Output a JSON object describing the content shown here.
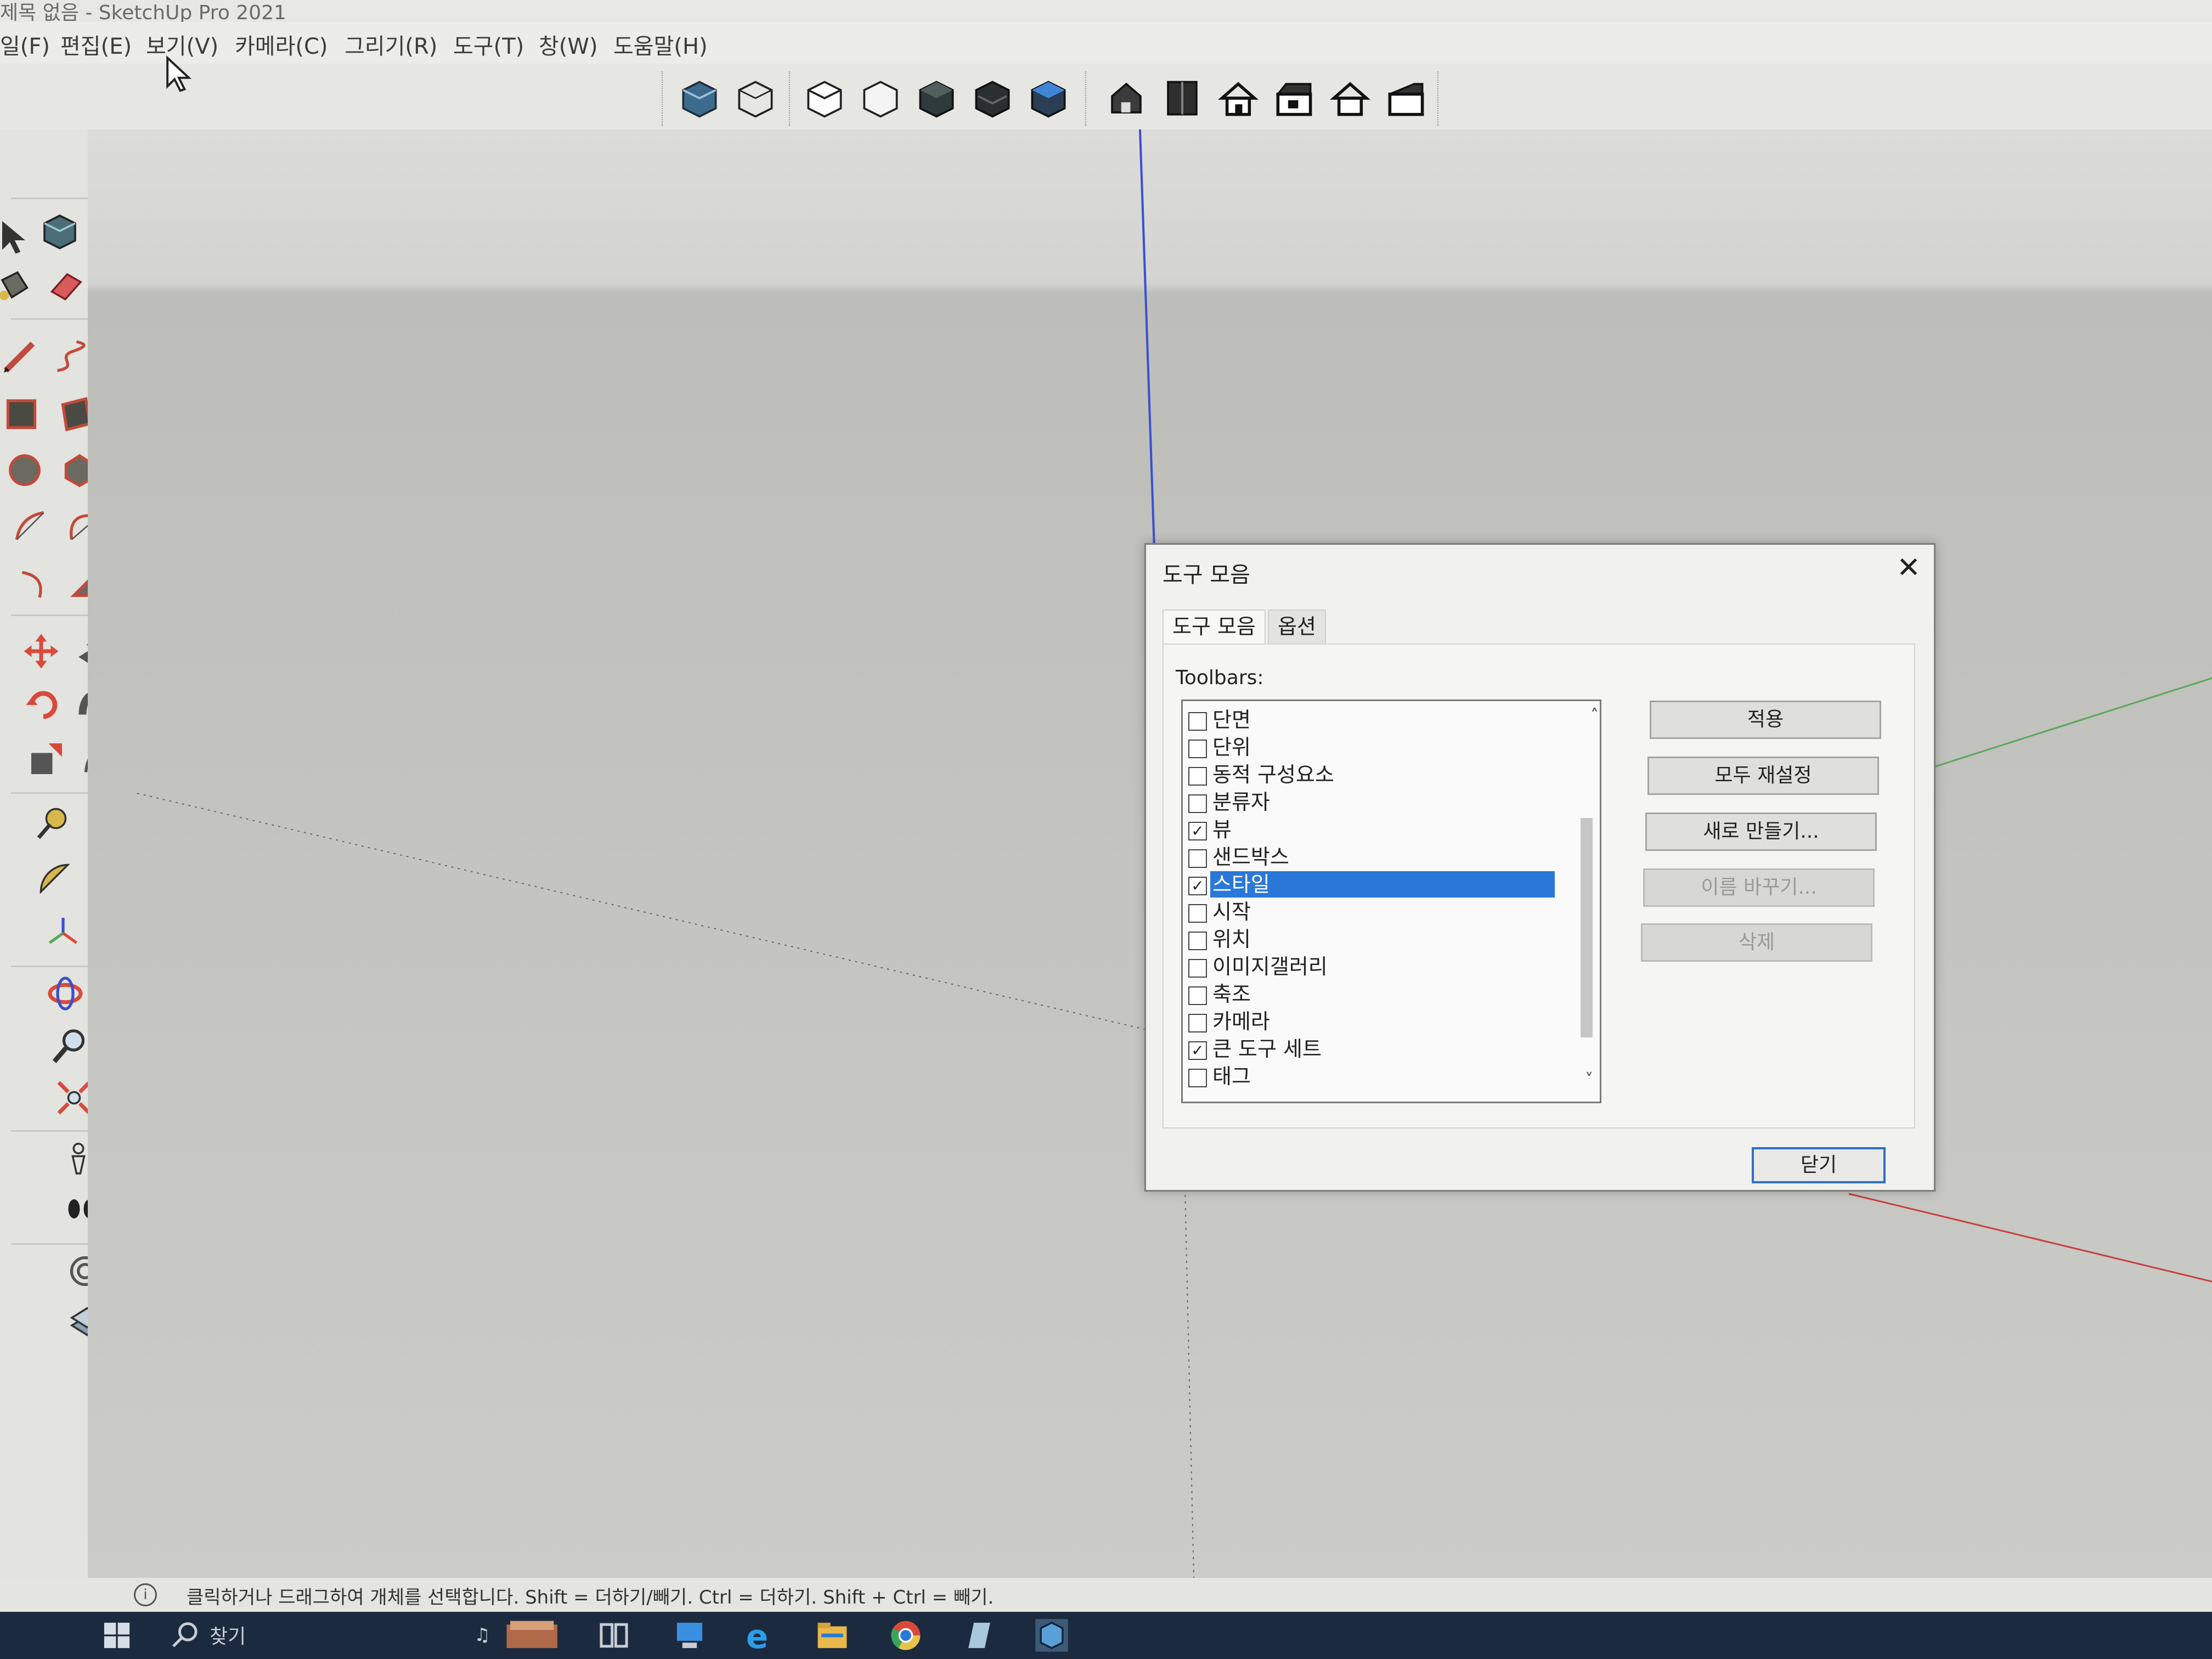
{
  "window": {
    "title": "제목 없음 - SketchUp Pro 2021"
  },
  "menu": {
    "items": [
      "일(F)",
      "편집(E)",
      "보기(V)",
      "카메라(C)",
      "그리기(R)",
      "도구(T)",
      "창(W)",
      "도움말(H)"
    ]
  },
  "top_toolbar": {
    "style_icons": [
      "xray-style-icon",
      "wireframe-style-icon",
      "hidden-line-style-icon",
      "hidden-line-white-icon",
      "shaded-style-icon",
      "shaded-textures-icon",
      "monochrome-style-icon"
    ],
    "view_icons": [
      "iso-view-icon",
      "top-view-icon",
      "front-view-icon",
      "right-view-icon",
      "back-view-icon",
      "left-view-icon"
    ]
  },
  "left_toolbar": {
    "icons": [
      "select-icon",
      "make-component-icon",
      "paint-bucket-icon",
      "eraser-icon",
      "pencil-line-icon",
      "freehand-icon",
      "rectangle-icon",
      "rotated-rectangle-icon",
      "circle-icon",
      "polygon-icon",
      "arc-icon",
      "two-point-arc-icon",
      "three-point-arc-icon",
      "pie-icon",
      "move-icon",
      "push-pull-icon",
      "rotate-icon",
      "follow-me-icon",
      "scale-icon",
      "offset-icon",
      "tape-measure-icon",
      "dimension-icon",
      "protractor-icon",
      "text-icon",
      "axes-icon",
      "3d-text-icon",
      "orbit-icon",
      "pan-icon",
      "zoom-icon",
      "zoom-window-icon",
      "zoom-extents-icon",
      "previous-view-icon",
      "position-camera-icon",
      "look-around-icon",
      "walk-icon",
      "section-plane-icon",
      "display-section-icon",
      "display-cuts-icon",
      "section-fill-icon",
      "section-settings-icon"
    ]
  },
  "dialog": {
    "title": "도구 모음",
    "close_glyph": "✕",
    "tabs": [
      "도구 모음",
      "옵션"
    ],
    "active_tab": "도구 모음",
    "toolbars_label": "Toolbars:",
    "toolbars": [
      {
        "label": "단면",
        "checked": false
      },
      {
        "label": "단위",
        "checked": false
      },
      {
        "label": "동적 구성요소",
        "checked": false
      },
      {
        "label": "분류자",
        "checked": false
      },
      {
        "label": "뷰",
        "checked": true
      },
      {
        "label": "샌드박스",
        "checked": false
      },
      {
        "label": "스타일",
        "checked": true,
        "selected": true
      },
      {
        "label": "시작",
        "checked": false
      },
      {
        "label": "위치",
        "checked": false
      },
      {
        "label": "이미지갤러리",
        "checked": false
      },
      {
        "label": "축조",
        "checked": false
      },
      {
        "label": "카메라",
        "checked": false
      },
      {
        "label": "큰 도구 세트",
        "checked": true
      },
      {
        "label": "태그",
        "checked": false
      }
    ],
    "scroll_up_glyph": "˄",
    "scroll_down_glyph": "˅",
    "buttons": {
      "apply": "적용",
      "reset_all": "모두 재설정",
      "new": "새로 만들기...",
      "rename": "이름 바꾸기...",
      "delete": "삭제",
      "close": "닫기"
    }
  },
  "status_bar": {
    "info_glyph": "i",
    "text": "클릭하거나 드래그하여 개체를 선택합니다. Shift = 더하기/빼기. Ctrl = 더하기. Shift + Ctrl = 빼기."
  },
  "taskbar": {
    "search_placeholder": "찾기"
  },
  "colors": {
    "selection": "#2a78d8",
    "axis_blue": "#3a4fd0",
    "axis_red": "#c84040",
    "axis_green": "#5aa85a",
    "taskbar": "#1c2a3f"
  }
}
